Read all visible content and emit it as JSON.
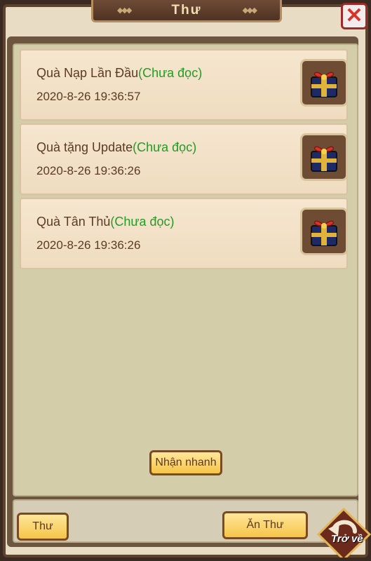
{
  "window": {
    "title": "Thư"
  },
  "mail_list": [
    {
      "title": "Quà Nạp Lần Đầu",
      "status": "(Chưa đọc)",
      "date": "2020-8-26 19:36:57",
      "icon": "gift-box-icon"
    },
    {
      "title": "Quà tặng Update",
      "status": "(Chưa đọc)",
      "date": "2020-8-26 19:36:26",
      "icon": "gift-box-icon"
    },
    {
      "title": "Quà Tân Thủ",
      "status": "(Chưa đọc)",
      "date": "2020-8-26 19:36:26",
      "icon": "gift-box-icon"
    }
  ],
  "buttons": {
    "quick_claim": "Nhận nhanh",
    "mail_tab": "Thư",
    "hide_mail": "Ăn Thư",
    "back": "Trở về"
  },
  "colors": {
    "unread": "#249b24",
    "close": "#d8322c",
    "button_gold": "#f6c548"
  }
}
